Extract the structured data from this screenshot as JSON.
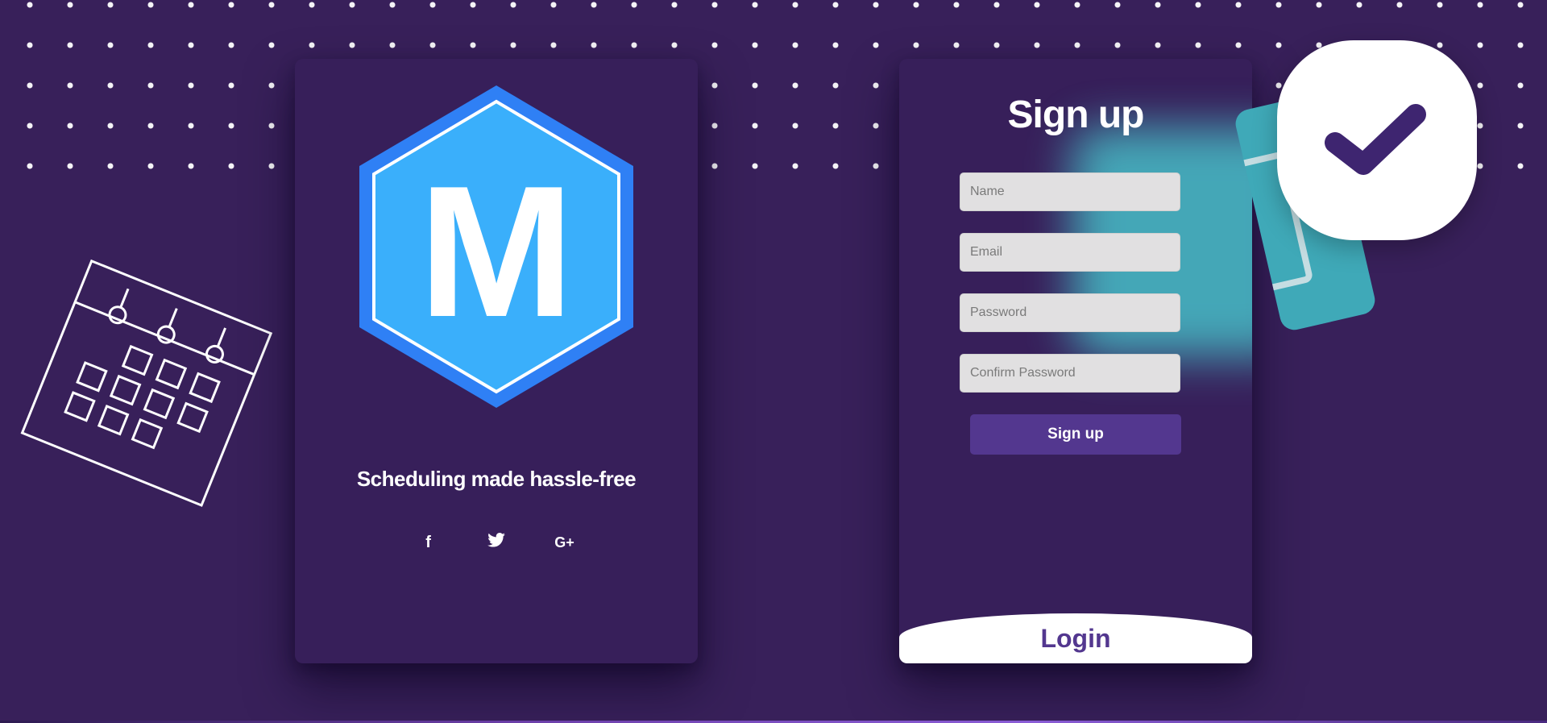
{
  "brand": {
    "logo_letter": "M",
    "tagline": "Scheduling made hassle-free",
    "socials": [
      {
        "icon": "facebook-icon",
        "glyph": "f"
      },
      {
        "icon": "twitter-icon",
        "glyph": "twitter"
      },
      {
        "icon": "google-plus-icon",
        "glyph": "G+"
      }
    ]
  },
  "signup": {
    "title": "Sign up",
    "fields": {
      "name_placeholder": "Name",
      "email_placeholder": "Email",
      "password_placeholder": "Password",
      "confirm_placeholder": "Confirm Password"
    },
    "submit_label": "Sign up",
    "login_label": "Login"
  },
  "colors": {
    "background": "#38205a",
    "card": "#371f5a",
    "accent": "#53378f",
    "hex_outer": "#2f80f5",
    "hex_inner": "#3aaffb",
    "teal": "#46b6c2"
  }
}
